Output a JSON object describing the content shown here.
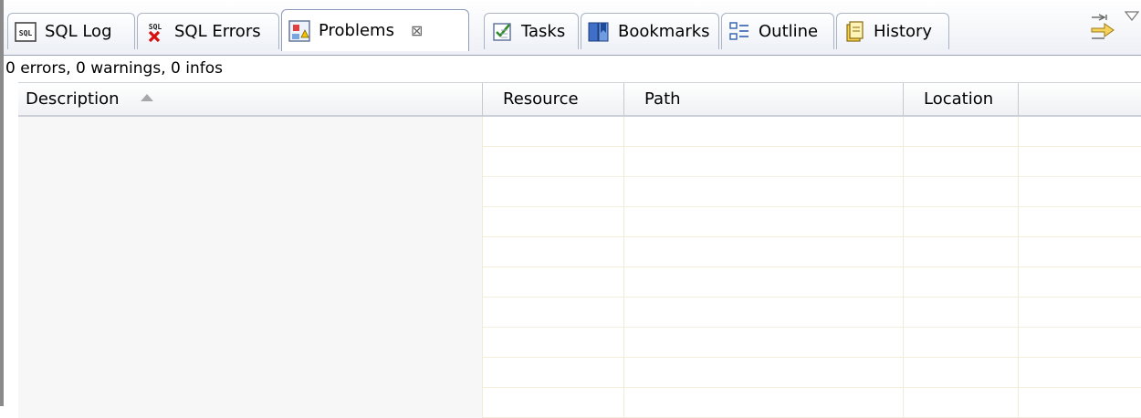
{
  "tabs": [
    {
      "label": "SQL Log",
      "icon": "sql-log-icon",
      "active": false
    },
    {
      "label": "SQL Errors",
      "icon": "sql-errors-icon",
      "active": false
    },
    {
      "label": "Problems",
      "icon": "problems-icon",
      "active": true,
      "close": "⊠"
    },
    {
      "label": "Tasks",
      "icon": "tasks-icon",
      "active": false
    },
    {
      "label": "Bookmarks",
      "icon": "bookmarks-icon",
      "active": false
    },
    {
      "label": "Outline",
      "icon": "outline-icon",
      "active": false
    },
    {
      "label": "History",
      "icon": "history-icon",
      "active": false
    }
  ],
  "sql_icon_text": "SQL",
  "status": {
    "text": "0 errors, 0 warnings, 0 infos"
  },
  "table": {
    "columns": [
      {
        "label": "Description",
        "sorted": true
      },
      {
        "label": "Resource"
      },
      {
        "label": "Path"
      },
      {
        "label": "Location"
      },
      {
        "label": ""
      }
    ]
  },
  "colors": {
    "accent": "#8d9db8",
    "row_line": "#f3efdc",
    "error_red": "#d81010"
  }
}
